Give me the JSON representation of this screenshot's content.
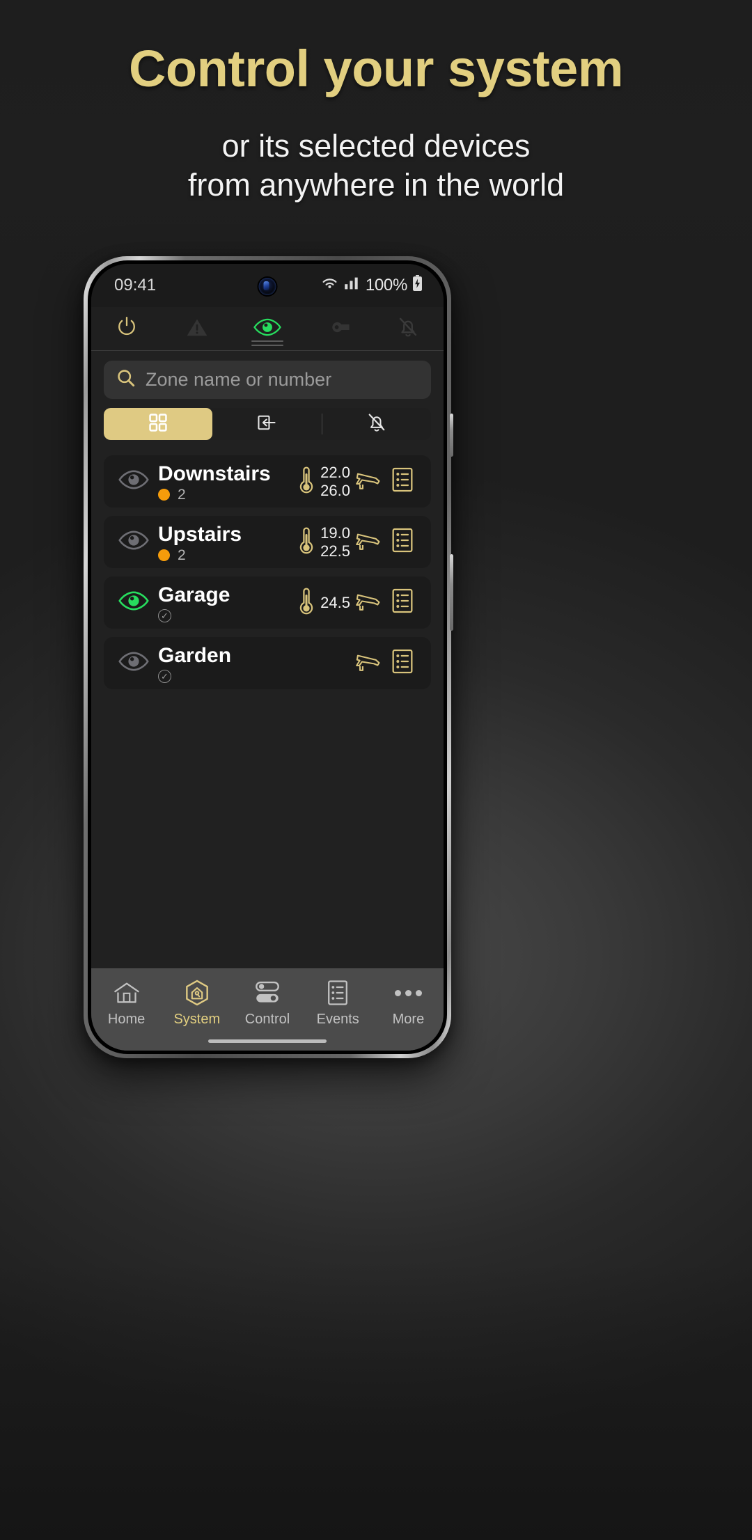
{
  "promo": {
    "headline": "Control your system",
    "subline_1": "or its selected devices",
    "subline_2": "from anywhere in the world",
    "accent_color": "#e2cf80",
    "text_color": "#f3f3f3"
  },
  "status_bar": {
    "time": "09:41",
    "wifi_icon": "wifi-icon",
    "signal_icon": "cellular-signal-icon",
    "battery_percent": "100%",
    "battery_icon": "battery-charging-icon"
  },
  "top_bar": {
    "items": [
      {
        "name": "power-icon",
        "state": "gold"
      },
      {
        "name": "warning-icon",
        "state": "dim"
      },
      {
        "name": "eye-icon",
        "state": "green-active"
      },
      {
        "name": "wrench-icon",
        "state": "dim"
      },
      {
        "name": "bell-off-icon",
        "state": "dim"
      }
    ]
  },
  "search": {
    "placeholder": "Zone name or number",
    "value": "",
    "icon": "search-icon"
  },
  "segmented": {
    "options": [
      {
        "icon": "grid-view-icon",
        "active": true
      },
      {
        "icon": "bypass-enter-icon",
        "active": false
      },
      {
        "icon": "bell-off-icon",
        "active": false
      }
    ],
    "active_color": "#dfca83"
  },
  "zones": [
    {
      "name": "Downstairs",
      "eye_icon": "eye-inactive-icon",
      "eye_state": "grey",
      "status_dot": "#f59c0b",
      "count": "2",
      "checked": false,
      "temp_icon": "thermometer-icon",
      "temp_high": "22.0",
      "temp_low": "26.0",
      "camera_icon": "cctv-camera-icon",
      "log_icon": "event-log-icon"
    },
    {
      "name": "Upstairs",
      "eye_icon": "eye-inactive-icon",
      "eye_state": "grey",
      "status_dot": "#f59c0b",
      "count": "2",
      "checked": false,
      "temp_icon": "thermometer-icon",
      "temp_high": "19.0",
      "temp_low": "22.5",
      "camera_icon": "cctv-camera-icon",
      "log_icon": "event-log-icon"
    },
    {
      "name": "Garage",
      "eye_icon": "eye-active-icon",
      "eye_state": "green",
      "status_dot": "",
      "count": "",
      "checked": true,
      "temp_icon": "thermometer-icon",
      "temp_high": "24.5",
      "temp_low": "",
      "camera_icon": "cctv-camera-icon",
      "log_icon": "event-log-icon"
    },
    {
      "name": "Garden",
      "eye_icon": "eye-inactive-icon",
      "eye_state": "grey",
      "status_dot": "",
      "count": "",
      "checked": true,
      "temp_icon": "",
      "temp_high": "",
      "temp_low": "",
      "camera_icon": "cctv-camera-icon",
      "log_icon": "event-log-icon"
    }
  ],
  "bottom_nav": {
    "items": [
      {
        "label": "Home",
        "icon": "home-icon",
        "active": false
      },
      {
        "label": "System",
        "icon": "hex-system-icon",
        "active": true
      },
      {
        "label": "Control",
        "icon": "toggles-icon",
        "active": false
      },
      {
        "label": "Events",
        "icon": "event-log-icon",
        "active": false
      },
      {
        "label": "More",
        "icon": "more-dots-icon",
        "active": false
      }
    ],
    "active_color": "#e2cf80"
  }
}
